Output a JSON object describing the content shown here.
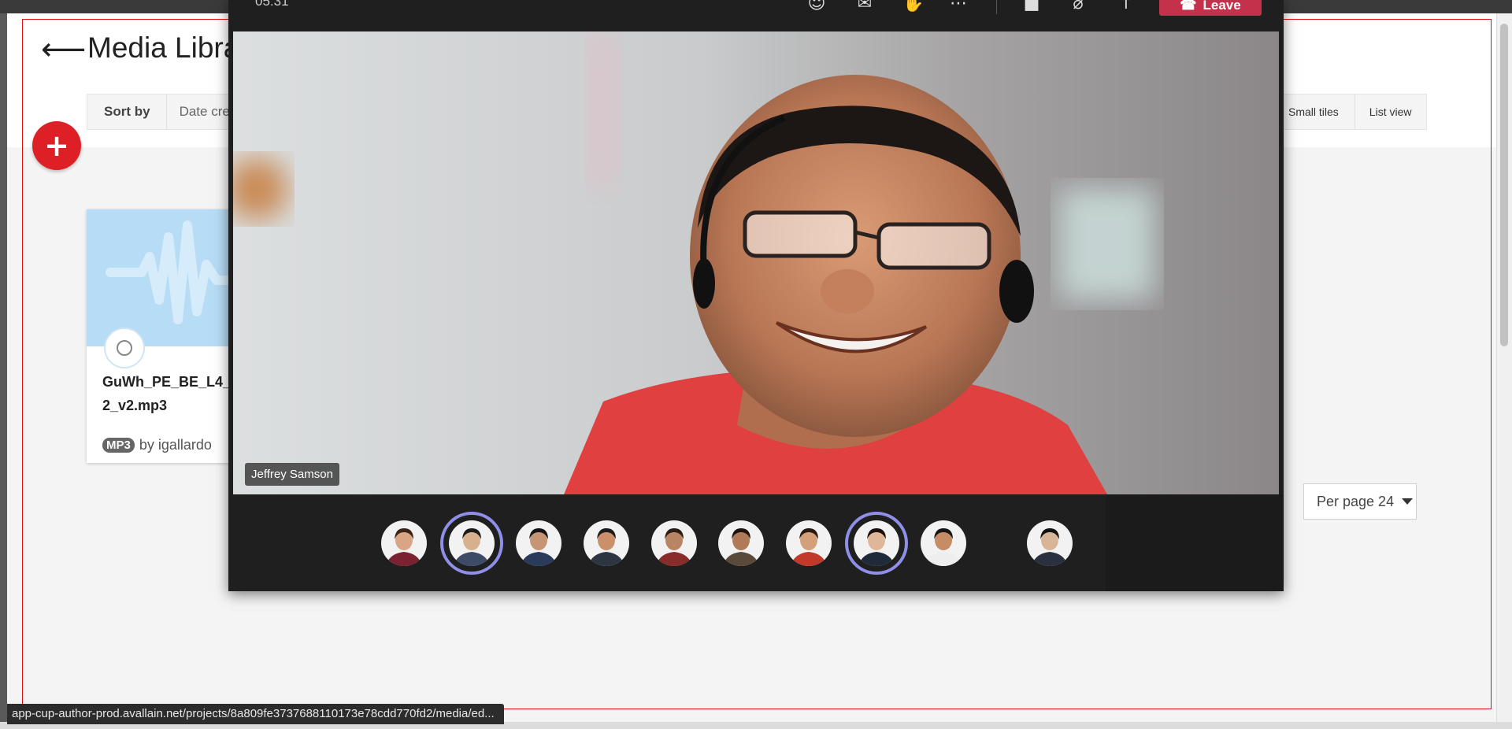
{
  "page": {
    "title": "Media Libra",
    "back_icon": "arrow-left-icon",
    "add_icon": "plus-icon"
  },
  "sort": {
    "label": "Sort by",
    "value": "Date cre"
  },
  "view_options": {
    "small_tiles": "Small tiles",
    "list_view": "List view"
  },
  "media_card": {
    "title": "GuWh_PE_BE_L4_2_v2.mp3",
    "title_line1": "GuWh_PE_BE_L4_",
    "title_line2": "2_v2.mp3",
    "badge": "MP3",
    "author": "by igallardo"
  },
  "pagination": {
    "per_page_label": "Per page 24"
  },
  "status_bar": {
    "url": "app-cup-author-prod.avallain.net/projects/8a809fe3737688110173e78cdd770fd2/media/ed..."
  },
  "call": {
    "timer": "05:31",
    "leave_label": "Leave",
    "leave_color": "#c4314b",
    "toolbar_icons": [
      "participants-icon",
      "chat-icon",
      "reactions-icon",
      "more-icon",
      "camera-off-icon",
      "mic-off-icon",
      "share-icon",
      "phone-hangup-icon"
    ],
    "speaker_name": "Jeffrey Samson",
    "participants": [
      {
        "id": "p1",
        "active": false,
        "shirt": "#7a2230",
        "skin": "#d8a585",
        "hair": "#3a2418"
      },
      {
        "id": "p2",
        "active": true,
        "shirt": "#3e4b66",
        "skin": "#d7b08e",
        "hair": "#1b1b1b"
      },
      {
        "id": "p3",
        "active": false,
        "shirt": "#2a3a5a",
        "skin": "#c69574",
        "hair": "#151515"
      },
      {
        "id": "p4",
        "active": false,
        "shirt": "#2e3542",
        "skin": "#c9906b",
        "hair": "#1c1c1c"
      },
      {
        "id": "p5",
        "active": false,
        "shirt": "#8a2b2b",
        "skin": "#b98464",
        "hair": "#2a1d14"
      },
      {
        "id": "p6",
        "active": false,
        "shirt": "#5a4a3a",
        "skin": "#b07a58",
        "hair": "#1e150f"
      },
      {
        "id": "p7",
        "active": false,
        "shirt": "#c0392b",
        "skin": "#d4a07a",
        "hair": "#2b1a10"
      },
      {
        "id": "p8",
        "active": true,
        "shirt": "#1f2a3a",
        "skin": "#e0b698",
        "hair": "#1a1010"
      },
      {
        "id": "p9",
        "active": false,
        "shirt": "#eeeeee",
        "skin": "#c58c66",
        "hair": "#161616"
      },
      {
        "id": "p10",
        "active": false,
        "shirt": "#2a3040",
        "skin": "#d9b497",
        "hair": "#121212"
      }
    ]
  },
  "colors": {
    "accent_red": "#dc2026",
    "outline_red": "#e01010",
    "thumb_blue": "#b7dcf6",
    "active_ring": "#8f8fe8"
  }
}
